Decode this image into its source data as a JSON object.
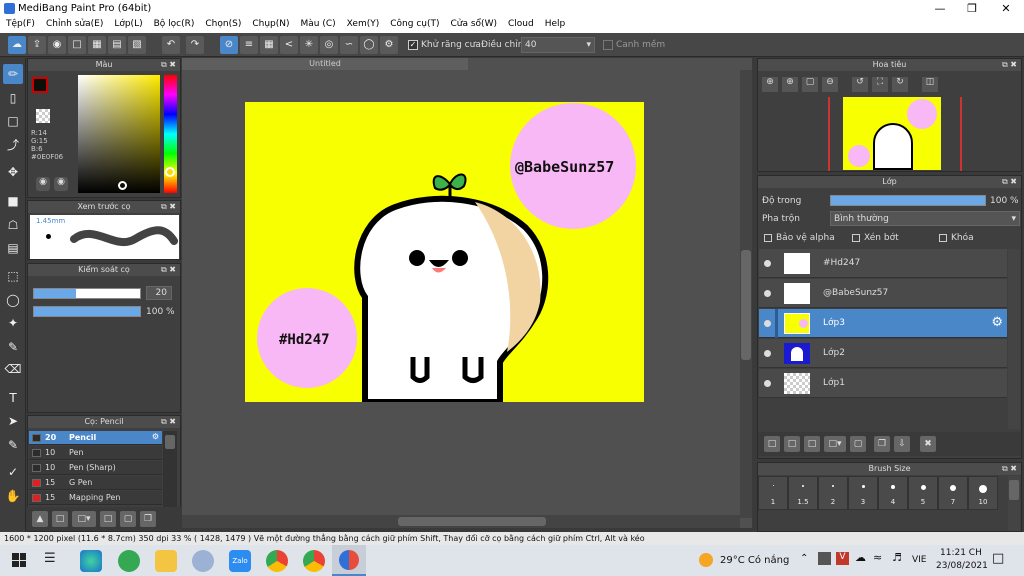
{
  "app": {
    "title": "MediBang Paint Pro (64bit)"
  },
  "menu": [
    "Tệp(F)",
    "Chỉnh sửa(E)",
    "Lớp(L)",
    "Bộ lọc(R)",
    "Chọn(S)",
    "Chụp(N)",
    "Màu (C)",
    "Xem(Y)",
    "Công cụ(T)",
    "Cửa sổ(W)",
    "Cloud",
    "Help"
  ],
  "toolbar": {
    "antialias_label": "Khử răng cưa",
    "adjust_label": "Điều chỉnh",
    "adjust_value": "40",
    "snap_label": "Canh mềm"
  },
  "colors": {
    "accent": "#4a87c9",
    "canvas_bg": "#f8ff00",
    "circle": "#f8b8f5"
  },
  "color_panel": {
    "title": "Màu",
    "r": "R:14",
    "g": "G:15",
    "b": "B:6",
    "hex": "#0E0F06"
  },
  "brush_preview": {
    "title": "Xem trước cọ",
    "size": "1.45mm"
  },
  "brush_control": {
    "title": "Kiểm soát cọ",
    "size": "20",
    "opacity": "100 %"
  },
  "brush_list": {
    "title": "Cọ: Pencil",
    "items": [
      {
        "size": "20",
        "name": "Pencil",
        "color": "#2c2c2c"
      },
      {
        "size": "10",
        "name": "Pen",
        "color": "#2c2c2c"
      },
      {
        "size": "10",
        "name": "Pen (Sharp)",
        "color": "#2c2c2c"
      },
      {
        "size": "15",
        "name": "G Pen",
        "color": "#e02020"
      },
      {
        "size": "15",
        "name": "Mapping Pen",
        "color": "#e02020"
      }
    ]
  },
  "document": {
    "tab": "Untitled",
    "text1": "@BabeSunz57",
    "text2": "#Hd247"
  },
  "navigator": {
    "title": "Hoa tiêu"
  },
  "layers": {
    "title": "Lớp",
    "opacity_label": "Độ trong",
    "opacity_value": "100 %",
    "blend_label": "Pha trộn",
    "blend_value": "Bình thường",
    "protect_alpha": "Bảo vệ alpha",
    "clipping": "Xén bớt",
    "lock": "Khóa",
    "items": [
      {
        "name": "#Hd247"
      },
      {
        "name": "@BabeSunz57"
      },
      {
        "name": "Lớp3"
      },
      {
        "name": "Lớp2"
      },
      {
        "name": "Lớp1"
      }
    ]
  },
  "brush_size": {
    "title": "Brush Size",
    "values": [
      "1",
      "1.5",
      "2",
      "3",
      "4",
      "5",
      "7",
      "10"
    ]
  },
  "status": {
    "text": "1600 * 1200 pixel  (11.6 * 8.7cm)  350 dpi  33 %  ( 1428, 1479 )  Vẽ một đường thẳng bằng cách giữ phím Shift, Thay đổi cỡ cọ bằng cách giữ phím Ctrl, Alt và kéo"
  },
  "taskbar": {
    "weather": "29°C  Có nắng",
    "lang": "VIE",
    "time": "11:21 CH",
    "date": "23/08/2021"
  }
}
